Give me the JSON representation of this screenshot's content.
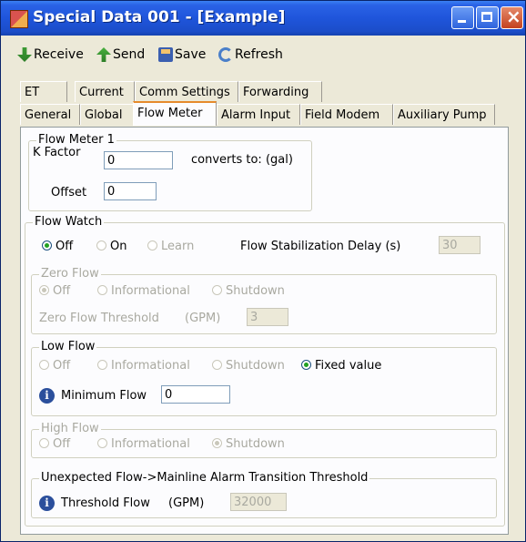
{
  "window": {
    "title": "Special Data 001 - [Example]",
    "controls": {
      "close_glyph": "×"
    },
    "colors": {
      "titlebar": "#1f55db",
      "active_tab_accent": "#e68b2c",
      "info_icon": "#2b4f9c"
    }
  },
  "toolbar": {
    "receive": "Receive",
    "send": "Send",
    "save": "Save",
    "refresh": "Refresh"
  },
  "tabs_row1": [
    "ET",
    "Current",
    "Comm Settings",
    "Forwarding"
  ],
  "tabs_row2": [
    "General",
    "Global",
    "Flow Meter",
    "Alarm Input",
    "Field Modem",
    "Auxiliary Pump"
  ],
  "active_tab": "Flow Meter",
  "flow_meter": {
    "legend": "Flow Meter 1",
    "k_factor_label": "K Factor",
    "k_factor_value": "0",
    "converts_to": "converts to: (gal)",
    "offset_label": "Offset",
    "offset_value": "0"
  },
  "flow_watch": {
    "legend": "Flow Watch",
    "off": "Off",
    "on": "On",
    "learn": "Learn",
    "selected": "Off",
    "stab_delay_label": "Flow Stabilization Delay (s)",
    "stab_delay_value": "30"
  },
  "zero_flow": {
    "legend": "Zero Flow",
    "off": "Off",
    "informational": "Informational",
    "shutdown": "Shutdown",
    "threshold_label": "Zero Flow Threshold",
    "unit": "(GPM)",
    "threshold_value": "3"
  },
  "low_flow": {
    "legend": "Low Flow",
    "off": "Off",
    "informational": "Informational",
    "shutdown": "Shutdown",
    "fixed_value": "Fixed value",
    "selected": "Fixed value",
    "min_flow_label": "Minimum Flow",
    "min_flow_value": "0"
  },
  "high_flow": {
    "legend": "High Flow",
    "off": "Off",
    "informational": "Informational",
    "shutdown": "Shutdown",
    "selected": "Shutdown"
  },
  "unexpected_flow": {
    "legend": "Unexpected Flow->Mainline Alarm Transition Threshold",
    "threshold_label": "Threshold Flow",
    "unit": "(GPM)",
    "threshold_value": "32000"
  },
  "icons": {
    "info": "i"
  }
}
